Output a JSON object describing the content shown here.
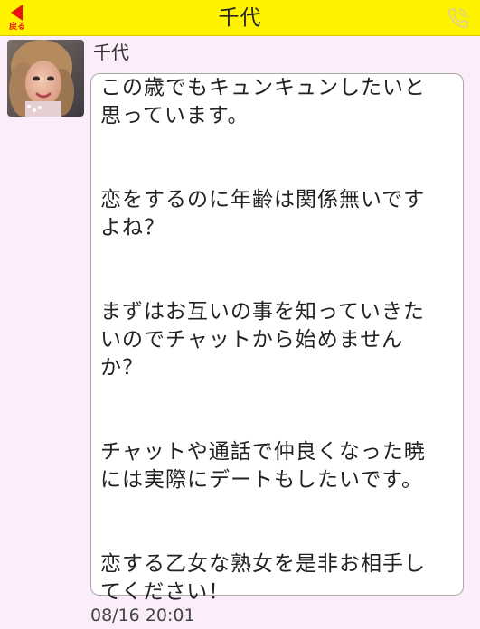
{
  "header": {
    "back_label": "戻る",
    "title": "千代",
    "call_icon": "phone-icon"
  },
  "message": {
    "sender": "千代",
    "text": "この歳でもキュンキュンしたいと\n思っています。\n\n\n恋をするのに年齢は関係無いです\nよね？\n\n\nまずはお互いの事を知っていきた\nいのでチャットから始めません\nか？\n\n\nチャットや通話で仲良くなった暁\nには実際にデートもしたいです。\n\n\n恋する乙女な熟女を是非お相手し\nてください！",
    "timestamp": "08/16 20:01"
  },
  "colors": {
    "header_bg": "#fff200",
    "accent_red": "#e8150f",
    "page_bg": "#fbeefa"
  }
}
